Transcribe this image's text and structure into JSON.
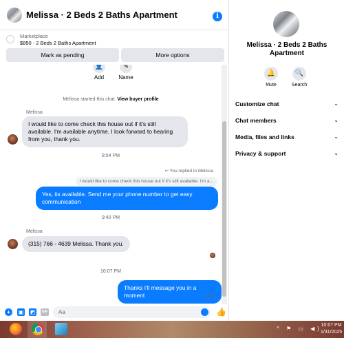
{
  "header": {
    "title": "Melissa · 2 Beds 2 Baths Apartment",
    "info_icon": "info-icon"
  },
  "marketplace": {
    "label": "Marketplace",
    "listing": "$850 · 2 Beds 2 Baths Apartment",
    "mark_pending": "Mark as pending",
    "more_options": "More options"
  },
  "quick_actions": {
    "add": "Add",
    "name": "Name"
  },
  "conversation": {
    "started_text": "Melissa started this chat.",
    "view_profile": "View buyer profile",
    "sender_name_1": "Melissa",
    "msg1": "I would like to come check this house out if it's still available. I'm available anytime. I look forward to hearing from you, thank you.",
    "time1": "8:54 PM",
    "reply_note": "You replied to Melissa",
    "reply_quote": "I would like to come check this house out if it's still available. I'm a...",
    "msg2": "Yes, its available. Send me your phone number to get easy communication",
    "time2": "9:40 PM",
    "sender_name_2": "Melissa",
    "msg3": "(315) 766 - 4639 Melissa. Thank you.",
    "time3": "10:07 PM",
    "msg4": "Thanks I'll message you in a moment",
    "sent": "Sent"
  },
  "composer": {
    "placeholder": "Aa"
  },
  "side_panel": {
    "title": "Melissa · 2 Beds 2 Baths Apartment",
    "mute": "Mute",
    "search": "Search",
    "rows": [
      "Customize chat",
      "Chat members",
      "Media, files and links",
      "Privacy & support"
    ]
  },
  "taskbar": {
    "time": "10:07 PM",
    "date": "1/31/2025"
  },
  "colors": {
    "accent": "#0a7cff",
    "bubble_in": "#e4e6eb"
  }
}
